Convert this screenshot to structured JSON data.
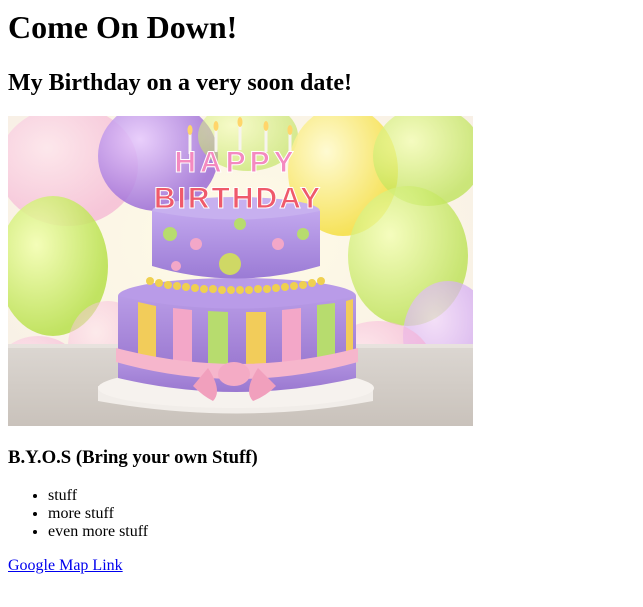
{
  "heading": "Come On Down!",
  "subheading": "My Birthday on a very soon date!",
  "photo": {
    "alt": "birthday cake",
    "topper_line1": "HAPPY",
    "topper_line2": "BIRTHDAY"
  },
  "byos_heading": "B.Y.O.S (Bring your own Stuff)",
  "stuff_list": [
    "stuff",
    "more stuff",
    "even more stuff"
  ],
  "map_link": {
    "label": "Google Map Link"
  },
  "colors": {
    "link": "#0000ee",
    "cake_top": "#a98ad8",
    "cake_bottom_stripe_pink": "#f3a7c8",
    "ribbon": "#f6b6cc"
  }
}
